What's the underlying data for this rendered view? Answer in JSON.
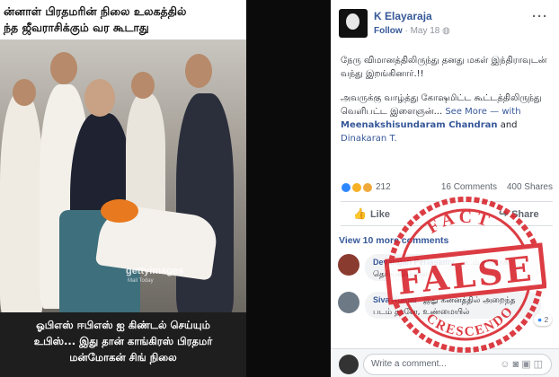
{
  "photo": {
    "top_text": [
      "ன்னாள் பிரதமரின் நிலை உலகத்தில்",
      "ந்த ஜீவராசிக்கும் வர கூடாது"
    ],
    "watermark": "gettyimages",
    "watermark_sub": "Mail Today",
    "caption": [
      "ஓபிஎஸ் ஈபிஎஸ் ஐ கிண்டல் செய்யும்",
      "உபிஸ்... இது தான் காங்கிரஸ் பிரதமர்",
      "மன்மோகன் சிங் நிலை"
    ]
  },
  "post": {
    "author": "K Elayaraja",
    "follow": "Follow",
    "date": "May 18",
    "paragraph1": "நேரு விமானத்திலிருந்து தனது மகள் இந்திராவுடன் வந்து இறங்கினார்.!!",
    "paragraph2": "அவருக்கு வாழ்த்து கோஷமிட்ட கூட்டத்திலிருந்து வெளிபட்ட இளைஞன்...",
    "see_more": "See More",
    "with_prefix": "— with",
    "tag1": "Meenakshisundaram Chandran",
    "and": "and",
    "tag2": "Dinakaran T."
  },
  "reactions": {
    "count": "212",
    "comments": "16 Comments",
    "shares": "400 Shares"
  },
  "actions": {
    "like": "Like",
    "share": "Share"
  },
  "comments": {
    "view_more": "View 10 more comments",
    "items": [
      {
        "name": "Devarajan Periasamy",
        "text": "படம் சரியாக தெரியவில்லை",
        "badge": ""
      },
      {
        "name": "Siva Kumar",
        "text": "இது கன்னத்தில் அறைந்த படம் தானே, உண்மையில்",
        "badge": "2"
      }
    ]
  },
  "write": {
    "placeholder": "Write a comment..."
  },
  "stamp": {
    "top": "FACT",
    "center": "FALSE",
    "bottom": "CRESCENDO"
  },
  "colors": {
    "link": "#365899",
    "stamp_red": "#d8222a"
  },
  "icons": [
    "more-options-icon",
    "like-icon",
    "share-icon",
    "camera-icon",
    "emoji-icon",
    "gif-icon",
    "sticker-icon"
  ]
}
